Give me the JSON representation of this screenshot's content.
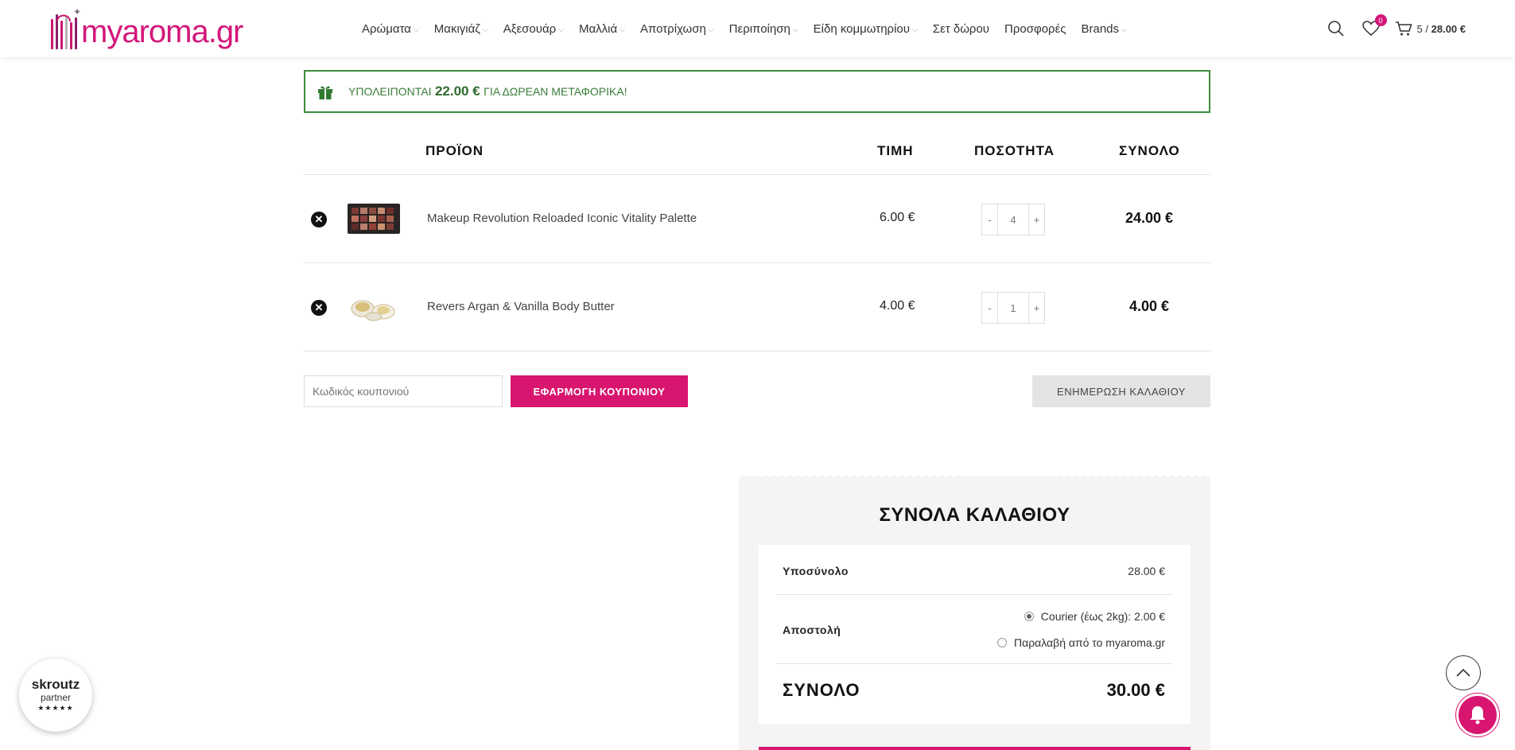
{
  "header": {
    "logo_text": "myaroma.gr",
    "nav": [
      {
        "label": "Αρώματα",
        "has_dropdown": true
      },
      {
        "label": "Μακιγιάζ",
        "has_dropdown": true
      },
      {
        "label": "Αξεσουάρ",
        "has_dropdown": true
      },
      {
        "label": "Μαλλιά",
        "has_dropdown": true
      },
      {
        "label": "Αποτρίχωση",
        "has_dropdown": true
      },
      {
        "label": "Περιποίηση",
        "has_dropdown": true
      },
      {
        "label": "Είδη κομμωτηρίου",
        "has_dropdown": true
      },
      {
        "label": "Σετ δώρου",
        "has_dropdown": false
      },
      {
        "label": "Προσφορές",
        "has_dropdown": false
      },
      {
        "label": "Brands",
        "has_dropdown": true
      }
    ],
    "wishlist_count": "0",
    "cart_count": "5",
    "cart_separator": "/",
    "cart_total": "28.00 €"
  },
  "notice": {
    "prefix": "ΥΠΟΛΕΙΠΟΝΤΑΙ",
    "amount": "22.00 €",
    "suffix": "ΓΙΑ ΔΩΡΕΑΝ ΜΕΤΑΦΟΡΙΚΑ!"
  },
  "cart_table": {
    "headers": {
      "product": "ΠΡΟΪΟΝ",
      "price": "ΤΙΜΗ",
      "quantity": "ΠΟΣΟΤΗΤΑ",
      "total": "ΣΥΝΟΛΟ"
    },
    "rows": [
      {
        "name": "Makeup Revolution Reloaded Iconic Vitality Palette",
        "price": "6.00 €",
        "qty": "4",
        "subtotal": "24.00 €"
      },
      {
        "name": "Revers Argan & Vanilla Body Butter",
        "price": "4.00 €",
        "qty": "1",
        "subtotal": "4.00 €"
      }
    ],
    "minus": "-",
    "plus": "+"
  },
  "coupon": {
    "placeholder": "Κωδικός κουπονιού",
    "apply_label": "ΕΦΑΡΜΟΓΗ ΚΟΥΠΟΝΙΟΥ",
    "update_label": "ΕΝΗΜΕΡΩΣΗ ΚΑΛΑΘΙΟΥ"
  },
  "totals": {
    "title": "ΣΥΝΟΛΑ ΚΑΛΑΘΙΟΥ",
    "subtotal_label": "Υποσύνολο",
    "subtotal_value": "28.00 €",
    "shipping_label": "Αποστολή",
    "shipping_options": [
      {
        "label": "Courier (έως 2kg): 2.00 €",
        "selected": true
      },
      {
        "label": "Παραλαβή από το myaroma.gr",
        "selected": false
      }
    ],
    "grand_label": "ΣΥΝΟΛΟ",
    "grand_value": "30.00 €"
  },
  "skroutz": {
    "brand": "skroutz",
    "sub": "partner",
    "stars": "★★★★★"
  },
  "colors": {
    "brand": "#d8156f",
    "notice_green": "#3c8c3c"
  }
}
